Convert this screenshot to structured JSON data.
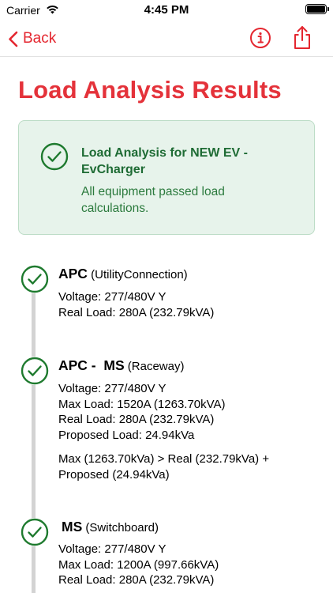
{
  "status_bar": {
    "carrier": "Carrier",
    "time": "4:45 PM"
  },
  "nav": {
    "back_label": "Back",
    "accent_color": "#e4262f"
  },
  "page": {
    "title": "Load Analysis Results"
  },
  "banner": {
    "title": "Load Analysis for NEW EV - EvCharger",
    "subtitle": "All equipment passed load calculations.",
    "status": "passed"
  },
  "equipment": [
    {
      "name": "APC",
      "type": "(UtilityConnection)",
      "voltage": "Voltage: 277/480V Y",
      "real_load": "Real Load: 280A (232.79kVA)"
    },
    {
      "name": "APC -  MS",
      "type": "(Raceway)",
      "voltage": "Voltage: 277/480V Y",
      "max_load": "Max Load: 1520A (1263.70kVA)",
      "real_load": "Real Load: 280A (232.79kVA)",
      "proposed_load": "Proposed Load: 24.94kVa",
      "note": "Max (1263.70kVa) > Real (232.79kVa) + Proposed (24.94kVa)"
    },
    {
      "name": "MS",
      "type": "(Switchboard)",
      "voltage": "Voltage: 277/480V Y",
      "max_load": "Max Load: 1200A (997.66kVA)",
      "real_load": "Real Load: 280A (232.79kVA)"
    }
  ]
}
